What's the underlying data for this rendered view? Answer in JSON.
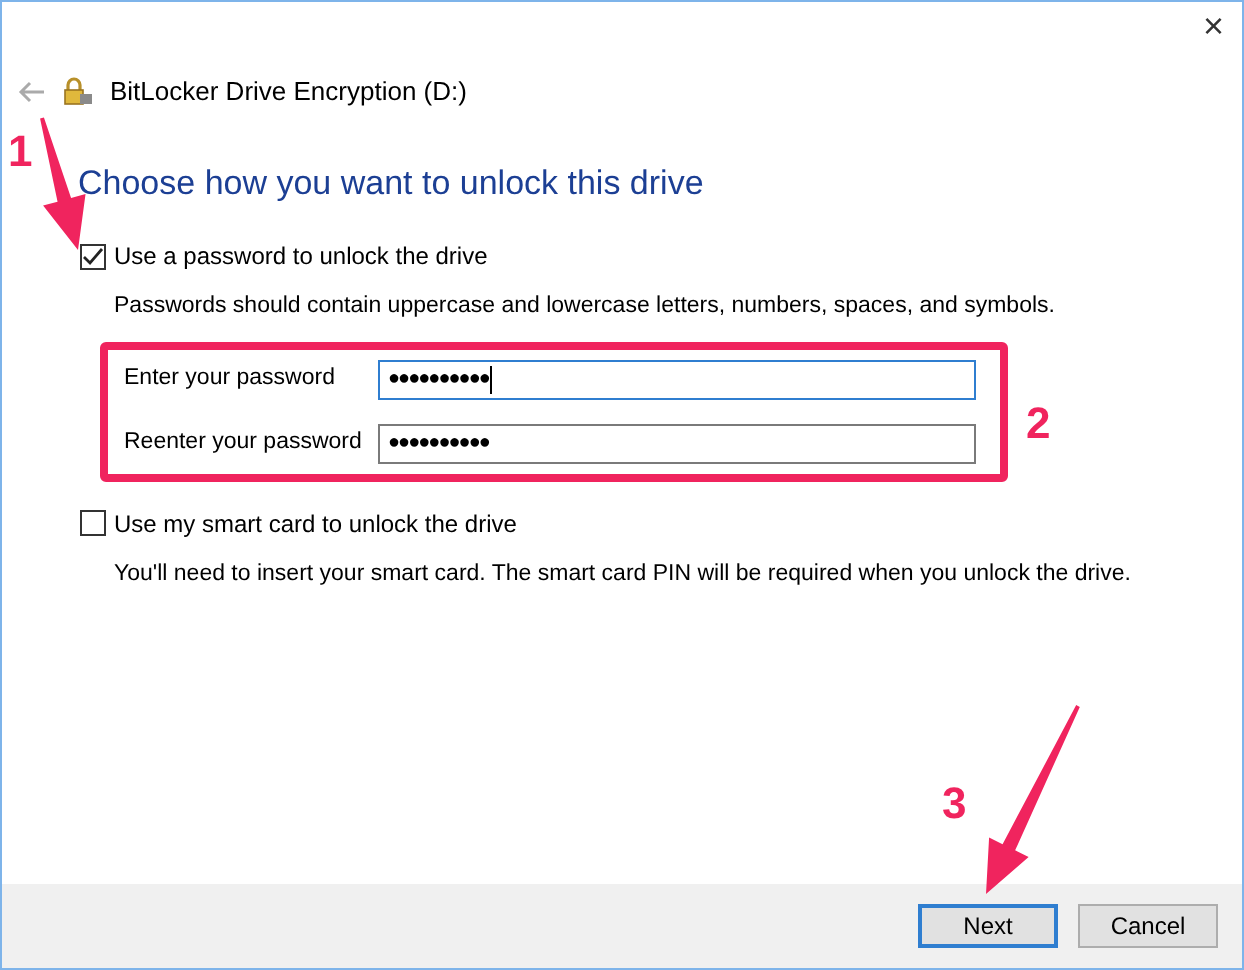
{
  "window": {
    "title": "BitLocker Drive Encryption (D:)",
    "close": "×"
  },
  "heading": "Choose how you want to unlock this drive",
  "options": [
    {
      "label": "Use a password to unlock the drive",
      "checked": true,
      "description": "Passwords should contain uppercase and lowercase letters, numbers, spaces, and symbols.",
      "fields": [
        {
          "label": "Enter your password",
          "value": "●●●●●●●●●●",
          "focused": true
        },
        {
          "label": "Reenter your password",
          "value": "●●●●●●●●●●",
          "focused": false
        }
      ]
    },
    {
      "label": "Use my smart card to unlock the drive",
      "checked": false,
      "description": "You'll need to insert your smart card. The smart card PIN will be required when you unlock the drive."
    }
  ],
  "buttons": [
    {
      "label": "Next",
      "default": true
    },
    {
      "label": "Cancel",
      "default": false
    }
  ],
  "annotations": [
    "1",
    "2",
    "3"
  ]
}
